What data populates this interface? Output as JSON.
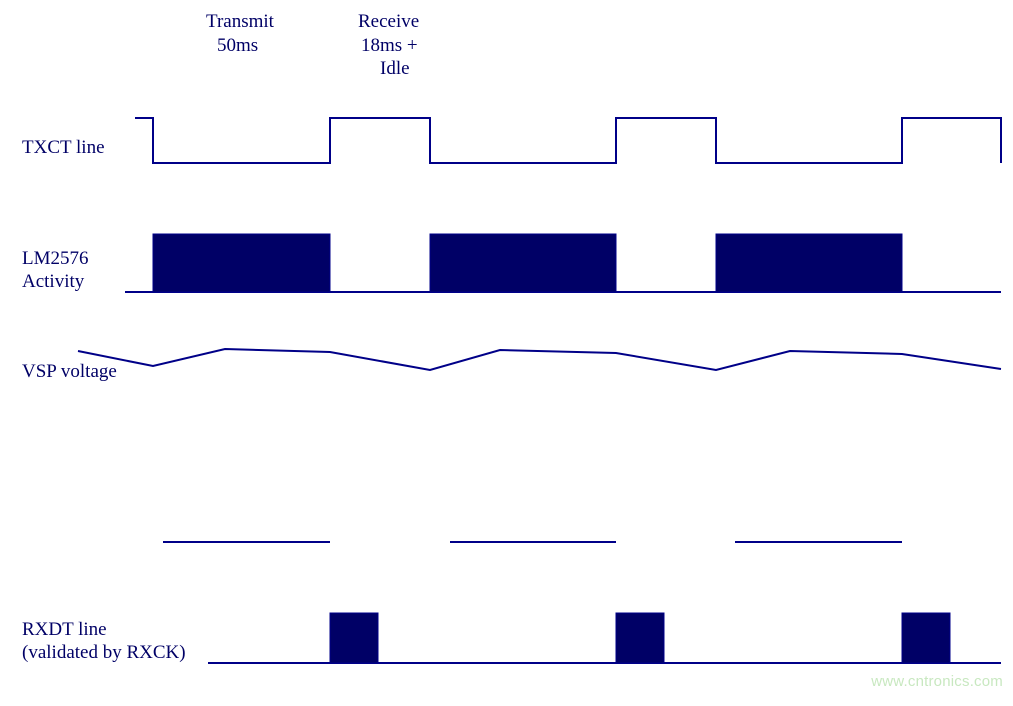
{
  "header": {
    "transmit_label": "Transmit",
    "transmit_duration": "50ms",
    "receive_label": "Receive",
    "receive_duration": "18ms +",
    "receive_suffix": "Idle"
  },
  "signals": {
    "txct_label": "TXCT line",
    "lm2576_label_line1": "LM2576",
    "lm2576_label_line2": "Activity",
    "vsp_label": "VSP voltage",
    "rxdt_label_line1": "RXDT line",
    "rxdt_label_line2": "(validated by RXCK)"
  },
  "watermark": "www.cntronics.com",
  "chart_data": {
    "type": "timing_diagram",
    "period_ms": 78,
    "cycles_shown": 3.2,
    "phases": [
      {
        "name": "Transmit",
        "duration_ms": 50
      },
      {
        "name": "Receive+Idle",
        "duration_ms": 28,
        "receive_ms": 18
      }
    ],
    "signals": [
      {
        "name": "TXCT line",
        "type": "digital",
        "description": "Low during Transmit (50ms), High during Receive/Idle",
        "pattern_per_cycle": [
          {
            "level": "low",
            "duration_ms": 50
          },
          {
            "level": "high",
            "duration_ms": 28
          }
        ]
      },
      {
        "name": "LM2576 Activity",
        "type": "digital",
        "description": "Active (high/filled) during Transmit, inactive during Receive/Idle",
        "pattern_per_cycle": [
          {
            "level": "high",
            "duration_ms": 50
          },
          {
            "level": "low",
            "duration_ms": 28
          }
        ]
      },
      {
        "name": "VSP voltage",
        "type": "analog",
        "description": "Voltage rises while LM2576 active then droops slightly during idle; small ripple",
        "pattern_per_cycle": "ramp up during Transmit, slight sag during Receive/Idle"
      },
      {
        "name": "RXDT line (validated by RXCK)",
        "type": "digital",
        "description": "Short high pulse at start of Receive window (~18ms), low otherwise",
        "pattern_per_cycle": [
          {
            "level": "low",
            "duration_ms": 50
          },
          {
            "level": "high",
            "duration_ms": 18
          },
          {
            "level": "low",
            "duration_ms": 10
          }
        ]
      },
      {
        "name": "gap line",
        "type": "digital_sparse",
        "description": "Horizontal segments present only during Transmit windows",
        "pattern_per_cycle": [
          {
            "present": true,
            "duration_ms": 50
          },
          {
            "present": false,
            "duration_ms": 28
          }
        ]
      }
    ]
  }
}
